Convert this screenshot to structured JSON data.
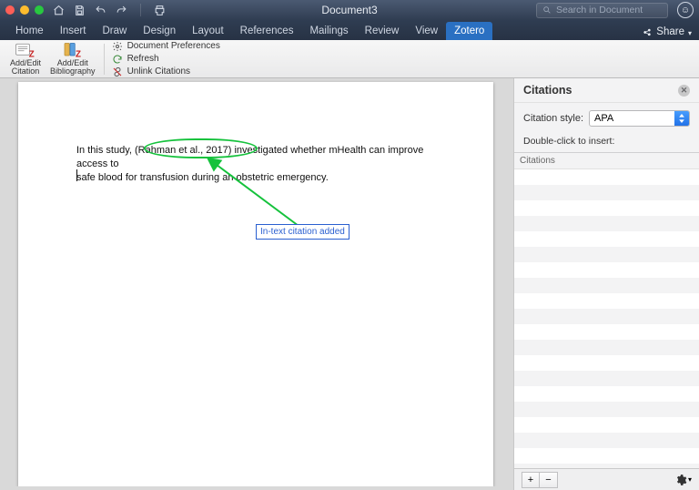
{
  "titlebar": {
    "document_title": "Document3"
  },
  "search": {
    "placeholder": "Search in Document"
  },
  "tabs": {
    "items": [
      "Home",
      "Insert",
      "Draw",
      "Design",
      "Layout",
      "References",
      "Mailings",
      "Review",
      "View",
      "Zotero"
    ],
    "active_index": 9,
    "share_label": "Share"
  },
  "ribbon": {
    "add_edit_citation": "Add/Edit\nCitation",
    "add_edit_bibliography": "Add/Edit\nBibliography",
    "document_preferences": "Document Preferences",
    "refresh": "Refresh",
    "unlink_citations": "Unlink Citations"
  },
  "document": {
    "text_before": "In this study, ",
    "citation_text": "(Rahman et al., 2017)",
    "text_after_1": " investigated whether mHealth can improve access to",
    "text_line2": "safe blood for transfusion during an obstetric emergency."
  },
  "annotation": {
    "callout_text": "In-text citation added"
  },
  "panel": {
    "title": "Citations",
    "style_label": "Citation style:",
    "style_value": "APA",
    "hint": "Double-click to insert:",
    "list_header": "Citations"
  },
  "footer_buttons": {
    "add": "+",
    "remove": "−"
  }
}
